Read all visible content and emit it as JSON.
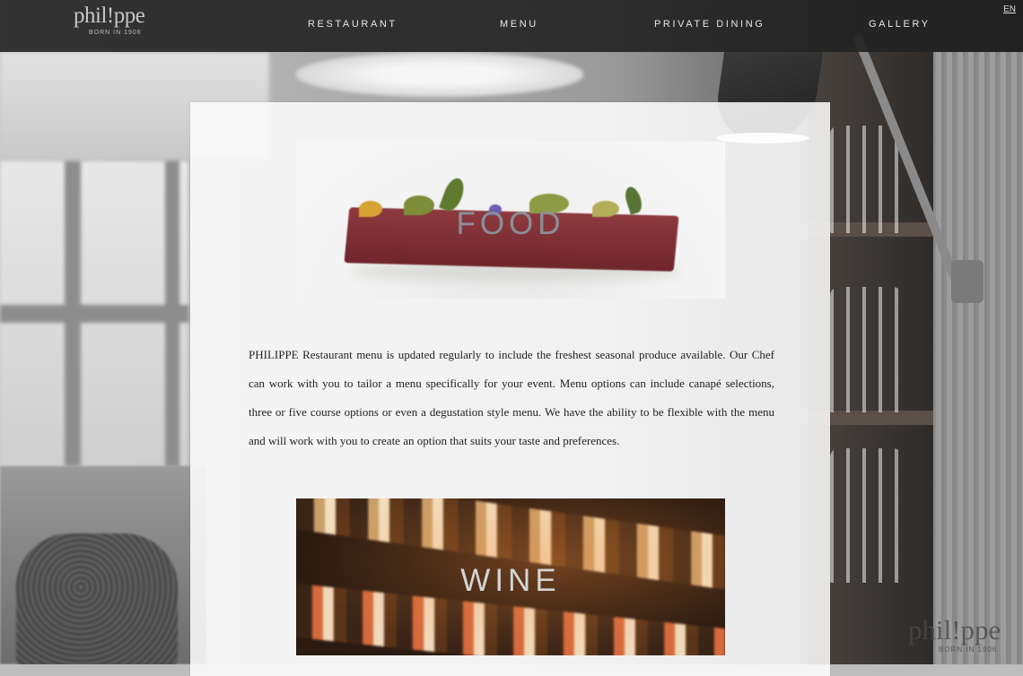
{
  "brand": {
    "logo_text": "phil!ppe",
    "tagline": "BORN IN 1906"
  },
  "nav": {
    "items": [
      {
        "label": "RESTAURANT"
      },
      {
        "label": "MENU"
      },
      {
        "label": "PRIVATE DINING"
      },
      {
        "label": "GALLERY"
      }
    ],
    "language": "EN"
  },
  "content": {
    "food_banner": {
      "title": "FOOD"
    },
    "description": "PHILIPPE Restaurant menu is updated regularly to include the freshest seasonal produce available. Our Chef can work with you to tailor a menu specifically for your event. Menu options can include canapé selections, three or five course options or even a degustation style menu. We have the ability to be flexible with the menu and will work with you to create an option that suits your taste and preferences.",
    "wine_banner": {
      "title": "WINE"
    }
  },
  "watermark": {
    "logo_text": "phil!ppe",
    "tagline": "BORN IN 1906"
  },
  "colors": {
    "navbar": "#1e1e1e",
    "nav_text": "#e8e8e8",
    "panel": "#ffffff",
    "body_text": "#222222"
  }
}
